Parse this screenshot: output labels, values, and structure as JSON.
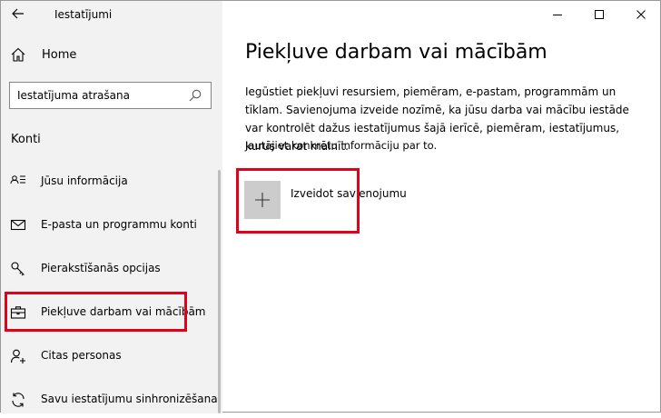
{
  "window": {
    "title": "Iestatījumi",
    "back_icon": "arrow-left-icon",
    "controls": [
      "minimize-icon",
      "maximize-icon",
      "close-icon"
    ]
  },
  "sidebar": {
    "home": {
      "label": "Home",
      "icon": "home-icon"
    },
    "search": {
      "placeholder": "Iestatījuma atrašana",
      "value": "",
      "icon": "search-icon"
    },
    "section_title": "Konti",
    "items": [
      {
        "label": "Jūsu informācija",
        "icon": "person-card-icon",
        "selected": false
      },
      {
        "label": "E-pasta un programmu konti",
        "icon": "mail-icon",
        "selected": false
      },
      {
        "label": "Pierakstīšanās opcijas",
        "icon": "key-icon",
        "selected": false
      },
      {
        "label": "Piekļuve darbam vai mācībām",
        "icon": "briefcase-icon",
        "selected": true
      },
      {
        "label": "Citas personas",
        "icon": "person-add-icon",
        "selected": false
      },
      {
        "label": "Savu iestatījumu sinhronizēšana",
        "icon": "sync-icon",
        "selected": false
      }
    ]
  },
  "main": {
    "title": "Piekļuve darbam vai mācībām",
    "description": "Iegūstiet piekļuvi resursiem, piemēram, e-pastam, programmām un tīklam. Savienojuma izveide nozīmē, ka jūsu darba vai mācību iestāde var kontrolēt dažus iestatījumus šajā ierīcē, piemēram, iestatījumus, kurus varat mainīt.",
    "description_2": "Jautājiet konkrētu informāciju par to.",
    "connect": {
      "label": "Izveidot savienojumu",
      "icon": "plus-icon"
    }
  },
  "colors": {
    "sidebar_bg": "#f2f2f2",
    "highlight": "#e2001a",
    "plus_tile": "#cccccc"
  }
}
